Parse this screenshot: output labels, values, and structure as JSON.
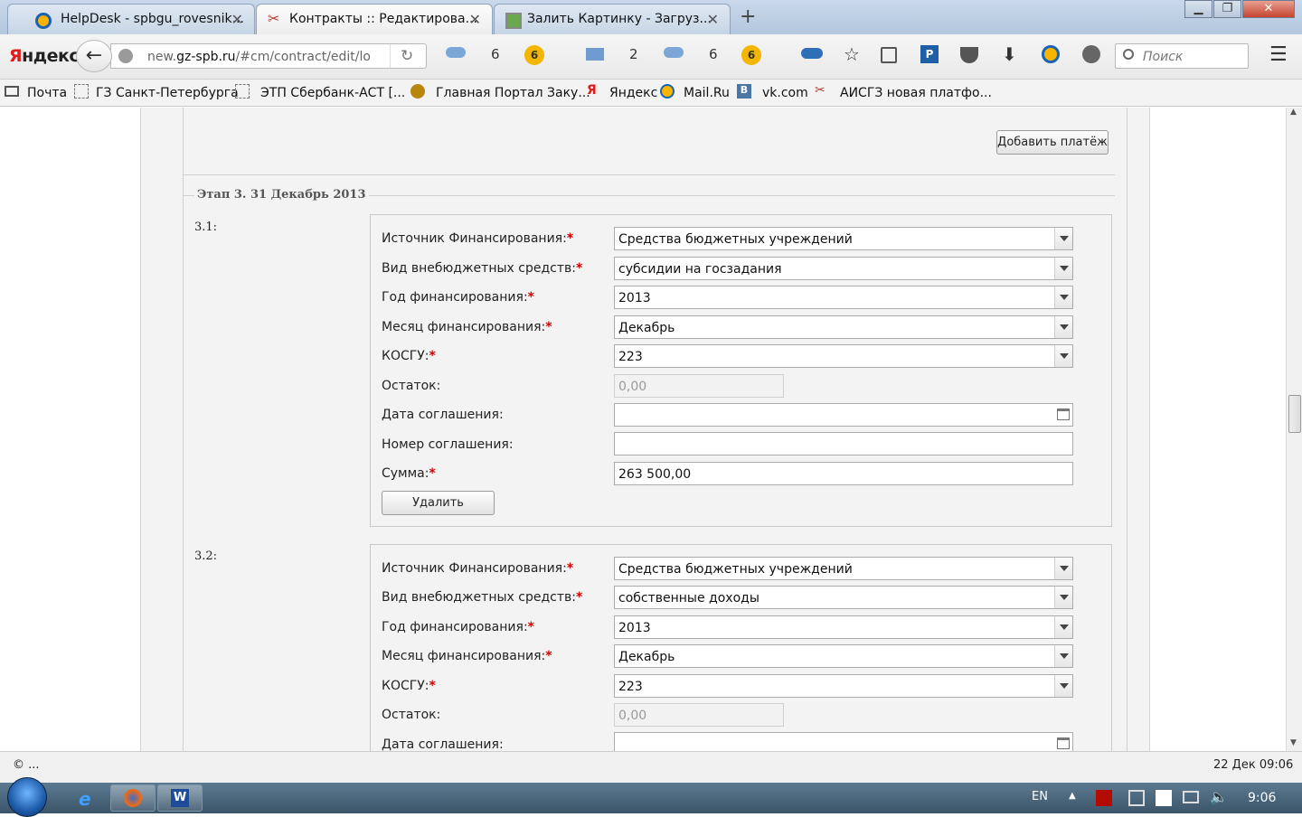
{
  "browser": {
    "tabs": [
      {
        "title": "HelpDesk - spbgu_rovesnik...",
        "icon": "mailru-at-icon",
        "active": false
      },
      {
        "title": "Контракты :: Редактирова...",
        "icon": "tools-icon",
        "active": true
      },
      {
        "title": "Залить Картинку - Загруз...",
        "icon": "picture-icon",
        "active": false
      }
    ],
    "logo": {
      "first": "Я",
      "rest": "ндекс"
    },
    "url": {
      "prefix": "new.",
      "domain": "gz-spb.ru",
      "path": "/#cm/contract/edit/lo"
    },
    "toolbar_counts": {
      "cloud1": "6",
      "mail": "2",
      "cloud2": "6"
    },
    "badges": {
      "b1": "6",
      "b2": "6"
    },
    "search_placeholder": "Поиск"
  },
  "bookmarks": [
    {
      "label": "Почта",
      "icon": "mail-icon"
    },
    {
      "label": "ГЗ Санкт-Петербурга",
      "icon": "blank-page-icon"
    },
    {
      "label": "ЭТП Сбербанк-АСТ [...",
      "icon": "blank-page-icon"
    },
    {
      "label": "Главная Портал Заку...",
      "icon": "eagle-emblem-icon"
    },
    {
      "label": "Яндекс",
      "icon": "yandex-icon"
    },
    {
      "label": "Mail.Ru",
      "icon": "mailru-icon"
    },
    {
      "label": "vk.com",
      "icon": "vk-icon"
    },
    {
      "label": "АИСГЗ новая платфо...",
      "icon": "tools-icon"
    }
  ],
  "page": {
    "add_payment_button": "Добавить платёж",
    "stage_legend": "Этап 3. 31 Декабрь 2013",
    "labels": {
      "source": "Источник Финансирования:",
      "type": "Вид внебюджетных средств:",
      "year": "Год финансирования:",
      "month": "Месяц финансирования:",
      "kosgu": "КОСГУ:",
      "remainder": "Остаток:",
      "agreement_date": "Дата соглашения:",
      "agreement_number": "Номер соглашения:",
      "sum": "Сумма:",
      "required_mark": "*"
    },
    "payments": [
      {
        "number": "3.1:",
        "source": "Средства бюджетных учреждений",
        "type": "субсидии на госзадания",
        "year": "2013",
        "month": "Декабрь",
        "kosgu": "223",
        "remainder": "0,00",
        "agreement_date": "",
        "agreement_number": "",
        "sum": "263 500,00",
        "delete_button": "Удалить"
      },
      {
        "number": "3.2:",
        "source": "Средства бюджетных учреждений",
        "type": "собственные доходы",
        "year": "2013",
        "month": "Декабрь",
        "kosgu": "223",
        "remainder": "0,00",
        "agreement_date": ""
      }
    ]
  },
  "status": {
    "left": "© ...",
    "right": "22 Дек 09:06"
  },
  "taskbar": {
    "lang": "EN",
    "time": "9:06"
  }
}
